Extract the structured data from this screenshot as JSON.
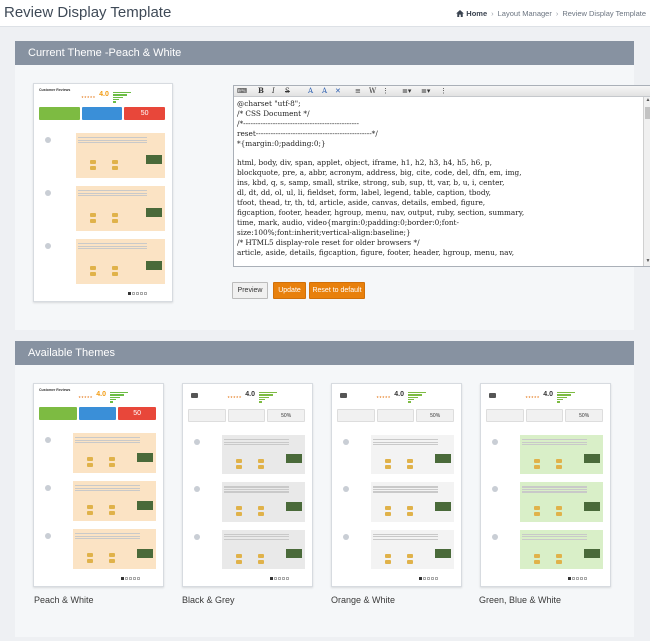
{
  "header": {
    "title": "Review Display Template",
    "breadcrumb": {
      "home": "Home",
      "items": [
        "Layout Manager",
        "Review Display Template"
      ]
    }
  },
  "current": {
    "heading": "Current Theme -Peach & White",
    "css_code": "@charset \"utf-8\";\n/* CSS Document */\n/*-----------------------------------------------\nreset-----------------------------------------------*/\n*{margin:0;padding:0;}\n\nhtml, body, div, span, applet, object, iframe, h1, h2, h3, h4, h5, h6, p,\nblockquote, pre, a, abbr, acronym, address, big, cite, code, del, dfn, em, img,\nins, kbd, q, s, samp, small, strike, strong, sub, sup, tt, var, b, u, i, center,\ndl, dt, dd, ol, ul, li, fieldset, form, label, legend, table, caption, tbody,\ntfoot, thead, tr, th, td, article, aside, canvas, details, embed, figure,\nfigcaption, footer, header, hgroup, menu, nav, output, ruby, section, summary,\ntime, mark, audio, video{margin:0;padding:0;border:0;font-\nsize:100%;font:inherit;vertical-align:baseline;}\n/* HTML5 display-role reset for older browsers */\narticle, aside, details, figcaption, figure, footer, header, hgroup, menu, nav,",
    "buttons": {
      "preview": "Preview",
      "update": "Update",
      "reset": "Reset to default"
    }
  },
  "available": {
    "heading": "Available Themes",
    "themes": [
      {
        "name": "Peach & White",
        "accent": "#fbe3c4"
      },
      {
        "name": "Black & Grey",
        "accent": "#e9e9e9"
      },
      {
        "name": "Orange & White",
        "accent": "#f3f3f3"
      },
      {
        "name": "Green, Blue & White",
        "accent": "#d9efc8"
      }
    ]
  },
  "preview": {
    "title": "Customer Reviews",
    "score": "4.0",
    "percent": "50%",
    "big_percent": "50"
  },
  "colors": {
    "panel_header": "#8792a1",
    "button_orange": "#e8800c",
    "green": "#7dbb42",
    "blue": "#3a8fd8",
    "red": "#e8473a"
  }
}
